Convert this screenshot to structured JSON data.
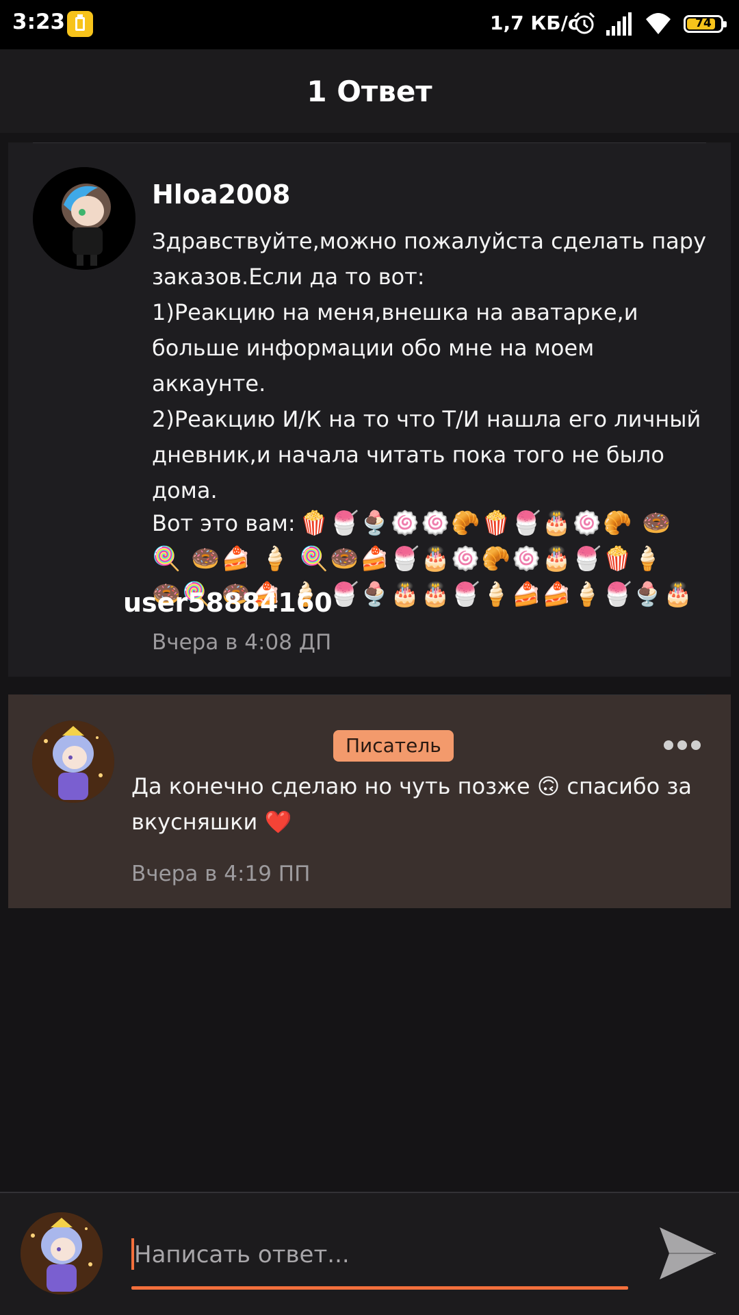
{
  "status_bar": {
    "time": "3:23",
    "network_speed": "1,7 КБ/с",
    "battery": "74",
    "icons": [
      "battery-saver-icon",
      "alarm-icon",
      "signal-icon",
      "wifi-icon",
      "battery-icon"
    ]
  },
  "header": {
    "title": "1 Ответ"
  },
  "original_comment": {
    "username": "Hloa2008",
    "text": "Здравствуйте,можно пожалуйста сделать пару\nзаказов.Если да то вот:\n1)Реакцию на меня,внешка на аватарке,и\nбольше информации обо мне на моем\nаккаунте.\n2)Реакцию И/К на то что Т/И нашла его личный\nдневник,и начала читать пока того не было\nдома.",
    "emoji_prefix": "Вот это вам:",
    "emoji_rows": [
      "🍿🍧🍨🍥🍥🥐🍿🍧🎂🍥🥐 🍩",
      "🍭 🍩🍰 🍦 🍭🍩🍰🍧🎂🍥🥐🍥🎂🍧🍿🍦",
      "🍩🍭 🍩🍰 🍦 🍧🍨🎂🎂🍧🍦🍰🍰🍦🍧🍨🎂"
    ],
    "timestamp": "Вчера в 4:08 ДП"
  },
  "reply_comment": {
    "username": "user58884160",
    "badge": "Писатель",
    "text": "Да конечно сделаю но чуть позже 🙃 спасибо за\nвкусняшки ❤️",
    "timestamp": "Вчера в 4:19 ПП"
  },
  "reply_bar": {
    "placeholder": "Написать ответ..."
  },
  "colors": {
    "accent": "#f36f3c",
    "badge_bg": "#f39a6c",
    "reply_card_bg": "#3a302d",
    "card_bg": "#1e1d20",
    "page_bg": "#151416"
  }
}
